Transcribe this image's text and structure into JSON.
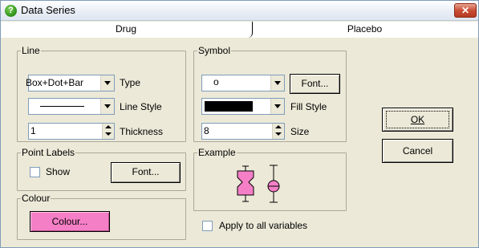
{
  "window": {
    "title": "Data Series"
  },
  "tabs": [
    {
      "label": "Drug"
    },
    {
      "label": "Placebo"
    }
  ],
  "line_group": {
    "label": "Line",
    "type_value": "Box+Dot+Bar",
    "type_label": "Type",
    "line_style_label": "Line Style",
    "thickness_value": "1",
    "thickness_label": "Thickness"
  },
  "symbol_group": {
    "label": "Symbol",
    "symbol_value": "o",
    "font_button": "Font...",
    "fill_style_label": "Fill Style",
    "size_value": "8",
    "size_label": "Size"
  },
  "point_labels": {
    "label": "Point Labels",
    "show_label": "Show",
    "font_button": "Font..."
  },
  "example": {
    "label": "Example"
  },
  "colour_group": {
    "label": "Colour",
    "button": "Colour...",
    "swatch_color": "#f57fc6"
  },
  "apply_all": {
    "label": "Apply to all variables"
  },
  "buttons": {
    "ok": "OK",
    "cancel": "Cancel"
  },
  "icons": {
    "title": "help-question-icon",
    "close": "close-icon"
  }
}
